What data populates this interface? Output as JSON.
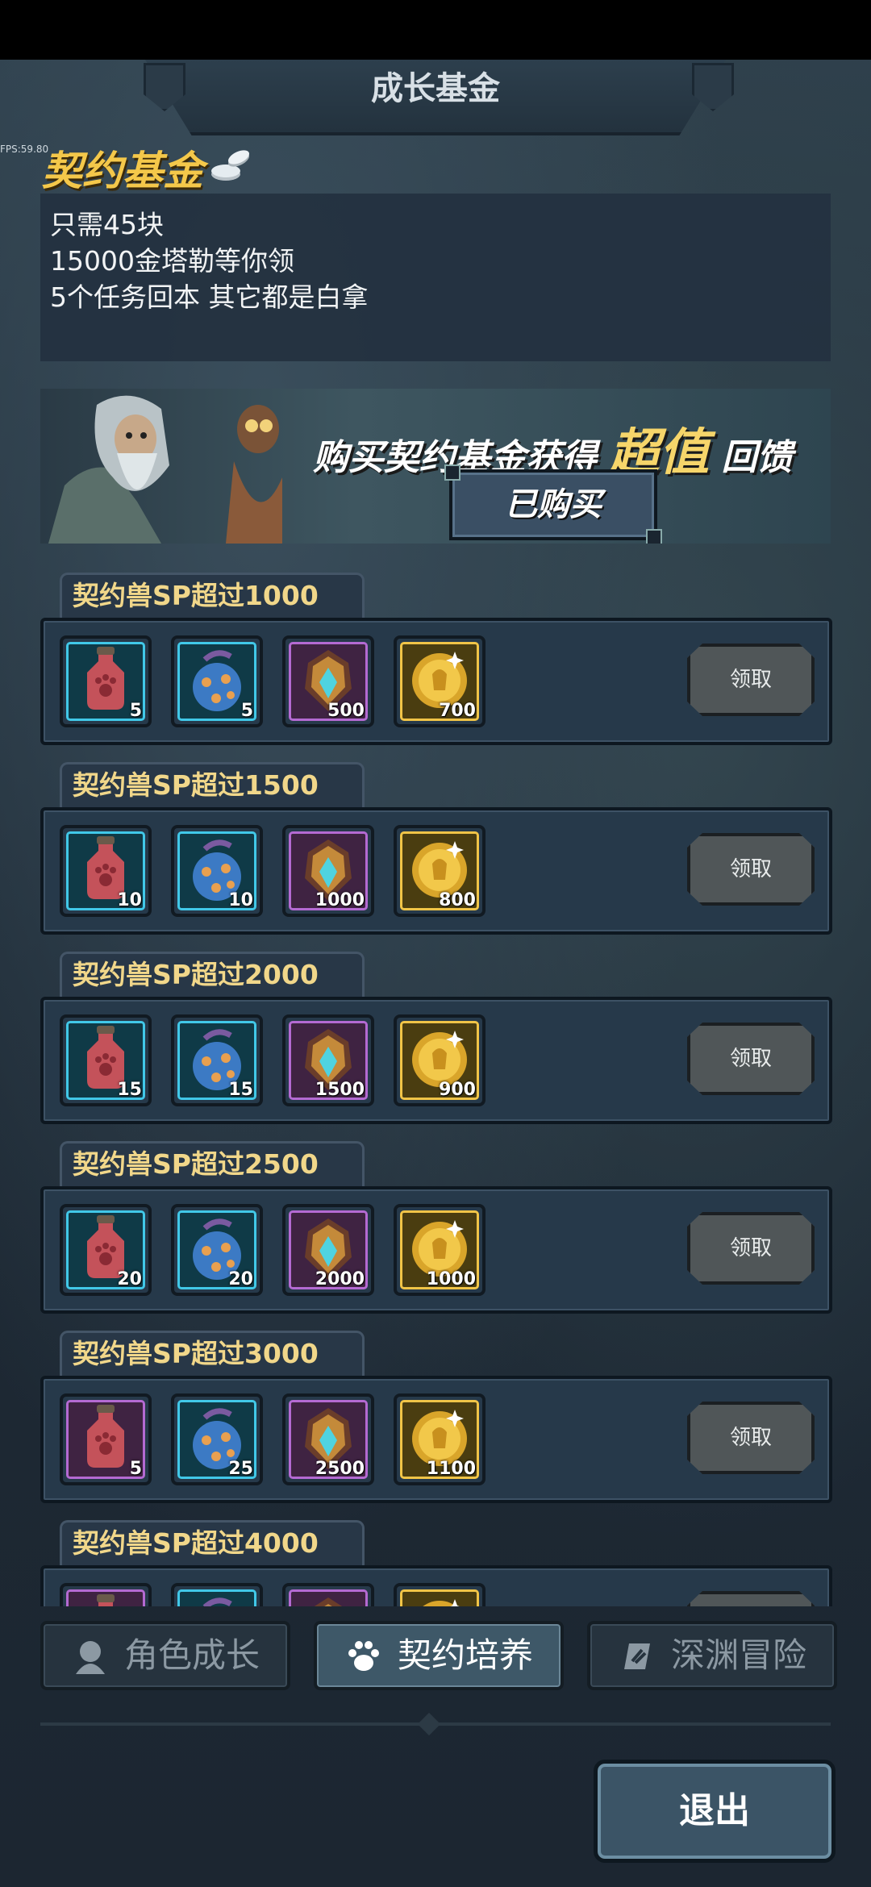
{
  "header": {
    "title": "成长基金",
    "fps": "FPS:59.80"
  },
  "fund": {
    "title": "契约基金",
    "lines": [
      "只需45块",
      "15000金塔勒等你领",
      "5个任务回本 其它都是白拿"
    ]
  },
  "promo": {
    "text_before": "购买契约基金获得",
    "highlight": "超值",
    "text_after": "回馈",
    "button": "已购买"
  },
  "tiers": [
    {
      "label": "契约兽SP超过1000",
      "rewards": [
        {
          "icon": "red-potion-icon",
          "rarity": "blue",
          "qty": "5"
        },
        {
          "icon": "blue-orb-icon",
          "rarity": "blue",
          "qty": "5"
        },
        {
          "icon": "crystal-crest-icon",
          "rarity": "purple",
          "qty": "500"
        },
        {
          "icon": "gold-coin-icon",
          "rarity": "gold",
          "qty": "700"
        }
      ],
      "claim": "领取"
    },
    {
      "label": "契约兽SP超过1500",
      "rewards": [
        {
          "icon": "red-potion-icon",
          "rarity": "blue",
          "qty": "10"
        },
        {
          "icon": "blue-orb-icon",
          "rarity": "blue",
          "qty": "10"
        },
        {
          "icon": "crystal-crest-icon",
          "rarity": "purple",
          "qty": "1000"
        },
        {
          "icon": "gold-coin-icon",
          "rarity": "gold",
          "qty": "800"
        }
      ],
      "claim": "领取"
    },
    {
      "label": "契约兽SP超过2000",
      "rewards": [
        {
          "icon": "red-potion-icon",
          "rarity": "blue",
          "qty": "15"
        },
        {
          "icon": "blue-orb-icon",
          "rarity": "blue",
          "qty": "15"
        },
        {
          "icon": "crystal-crest-icon",
          "rarity": "purple",
          "qty": "1500"
        },
        {
          "icon": "gold-coin-icon",
          "rarity": "gold",
          "qty": "900"
        }
      ],
      "claim": "领取"
    },
    {
      "label": "契约兽SP超过2500",
      "rewards": [
        {
          "icon": "red-potion-icon",
          "rarity": "blue",
          "qty": "20"
        },
        {
          "icon": "blue-orb-icon",
          "rarity": "blue",
          "qty": "20"
        },
        {
          "icon": "crystal-crest-icon",
          "rarity": "purple",
          "qty": "2000"
        },
        {
          "icon": "gold-coin-icon",
          "rarity": "gold",
          "qty": "1000"
        }
      ],
      "claim": "领取"
    },
    {
      "label": "契约兽SP超过3000",
      "rewards": [
        {
          "icon": "red-potion-icon",
          "rarity": "purple",
          "qty": "5"
        },
        {
          "icon": "blue-orb-icon",
          "rarity": "blue",
          "qty": "25"
        },
        {
          "icon": "crystal-crest-icon",
          "rarity": "purple",
          "qty": "2500"
        },
        {
          "icon": "gold-coin-icon",
          "rarity": "gold",
          "qty": "1100"
        }
      ],
      "claim": "领取"
    },
    {
      "label": "契约兽SP超过4000",
      "rewards": [
        {
          "icon": "red-potion-icon",
          "rarity": "purple",
          "qty": ""
        },
        {
          "icon": "blue-orb-icon",
          "rarity": "blue",
          "qty": ""
        },
        {
          "icon": "crystal-crest-icon",
          "rarity": "purple",
          "qty": ""
        },
        {
          "icon": "gold-coin-icon",
          "rarity": "gold",
          "qty": ""
        }
      ],
      "claim": ""
    }
  ],
  "tabs": [
    {
      "label": "角色成长",
      "icon": "character-icon",
      "active": false
    },
    {
      "label": "契约培养",
      "icon": "paw-icon",
      "active": true
    },
    {
      "label": "深渊冒险",
      "icon": "abyss-icon",
      "active": false
    }
  ],
  "exit_label": "退出",
  "colors": {
    "gold_title": "#f4c84a",
    "blue_rarity": "#41c8e8",
    "purple_rarity": "#b46ad2",
    "gold_rarity": "#f0c447"
  }
}
